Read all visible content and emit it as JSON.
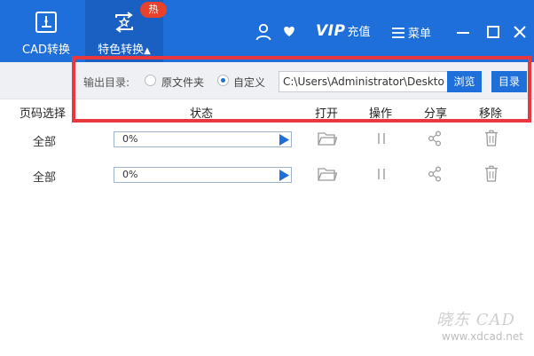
{
  "nav": {
    "cad_label": "CAD转换",
    "special_label": "特色转换",
    "special_caret": "▲",
    "hot_badge": "热"
  },
  "header": {
    "vip_logo": "VIP",
    "vip_text": "充值",
    "menu_label": "菜单"
  },
  "options": {
    "output_label": "输出目录:",
    "radio_original": "原文件夹",
    "radio_custom": "自定义",
    "selected": "custom",
    "path_value": "C:\\Users\\Administrator\\Desktop",
    "browse_label": "浏览",
    "dir_label": "目录"
  },
  "table": {
    "headers": {
      "page": "页码选择",
      "status": "状态",
      "open": "打开",
      "operation": "操作",
      "share": "分享",
      "remove": "移除"
    },
    "rows": [
      {
        "page": "全部",
        "progress_text": "0%",
        "progress": 0
      },
      {
        "page": "全部",
        "progress_text": "0%",
        "progress": 0
      }
    ]
  },
  "watermark": {
    "logo": "晓东 CAD",
    "url": "www.xdcad.net"
  },
  "colors": {
    "accent": "#1e6fd9",
    "accent_dark": "#1a5fc2",
    "badge": "#e8412c",
    "frame": "#e8373f",
    "icon_gray": "#9a9a9a"
  }
}
